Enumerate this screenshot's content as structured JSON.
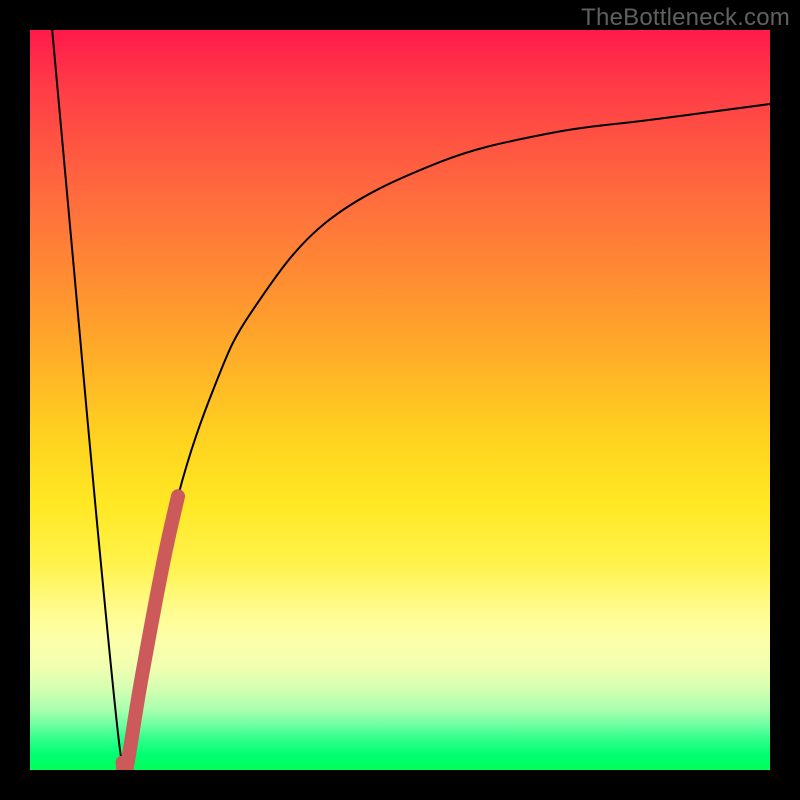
{
  "attribution": {
    "watermark": "TheBottleneck.com"
  },
  "chart_data": {
    "type": "line",
    "title": "",
    "xlabel": "",
    "ylabel": "",
    "ylim": [
      0,
      100
    ],
    "xlim": [
      0,
      100
    ],
    "background": {
      "kind": "vertical-gradient",
      "stops": [
        {
          "pos": 0,
          "color": "#ff1a4a"
        },
        {
          "pos": 50,
          "color": "#ffd21f"
        },
        {
          "pos": 80,
          "color": "#fdffa8"
        },
        {
          "pos": 100,
          "color": "#00ff58"
        }
      ]
    },
    "series": [
      {
        "name": "left-descent",
        "x": [
          3,
          6,
          9,
          12,
          13
        ],
        "y": [
          100,
          67,
          34,
          4,
          0
        ]
      },
      {
        "name": "right-growth",
        "x": [
          13,
          16,
          20,
          25,
          30,
          40,
          55,
          70,
          85,
          100
        ],
        "y": [
          0,
          18,
          37,
          52,
          62,
          74,
          82,
          86,
          88,
          90
        ]
      }
    ],
    "highlight": {
      "name": "selected-segment",
      "color": "#cc5a5a",
      "x": [
        12.5,
        13,
        15,
        18,
        20
      ],
      "y": [
        1,
        0,
        12,
        28,
        37
      ]
    }
  }
}
